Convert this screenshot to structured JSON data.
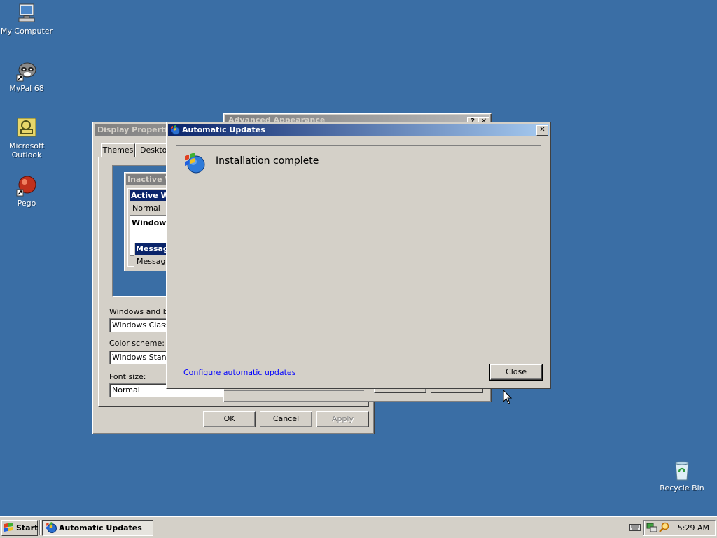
{
  "desktop": {
    "icons": [
      {
        "label": "My Computer"
      },
      {
        "label": "MyPal 68"
      },
      {
        "label": "Microsoft Outlook"
      },
      {
        "label": "Pego"
      },
      {
        "label": "Recycle Bin"
      }
    ]
  },
  "display_properties": {
    "title": "Display Properties",
    "tabs": [
      "Themes",
      "Desktop"
    ],
    "preview": {
      "inactive_title": "Inactive W",
      "active_title": "Active W",
      "menu": [
        "Normal"
      ],
      "window_text": "Window T",
      "message_title": "Messag",
      "message_text": "Message"
    },
    "windows_buttons_label": "Windows and bu",
    "windows_buttons_value": "Windows Classic",
    "color_scheme_label": "Color scheme:",
    "color_scheme_value": "Windows Standa",
    "font_size_label": "Font size:",
    "font_size_value": "Normal",
    "ok": "OK",
    "cancel": "Cancel",
    "apply": "Apply"
  },
  "advanced_appearance": {
    "title": "Advanced Appearance",
    "help": "?",
    "close": "✕"
  },
  "automatic_updates": {
    "title": "Automatic Updates",
    "message": "Installation complete",
    "link": "Configure automatic updates",
    "close_button": "Close",
    "title_close": "✕"
  },
  "taskbar": {
    "start": "Start",
    "task_button": "Automatic Updates",
    "clock": "5:29 AM"
  }
}
